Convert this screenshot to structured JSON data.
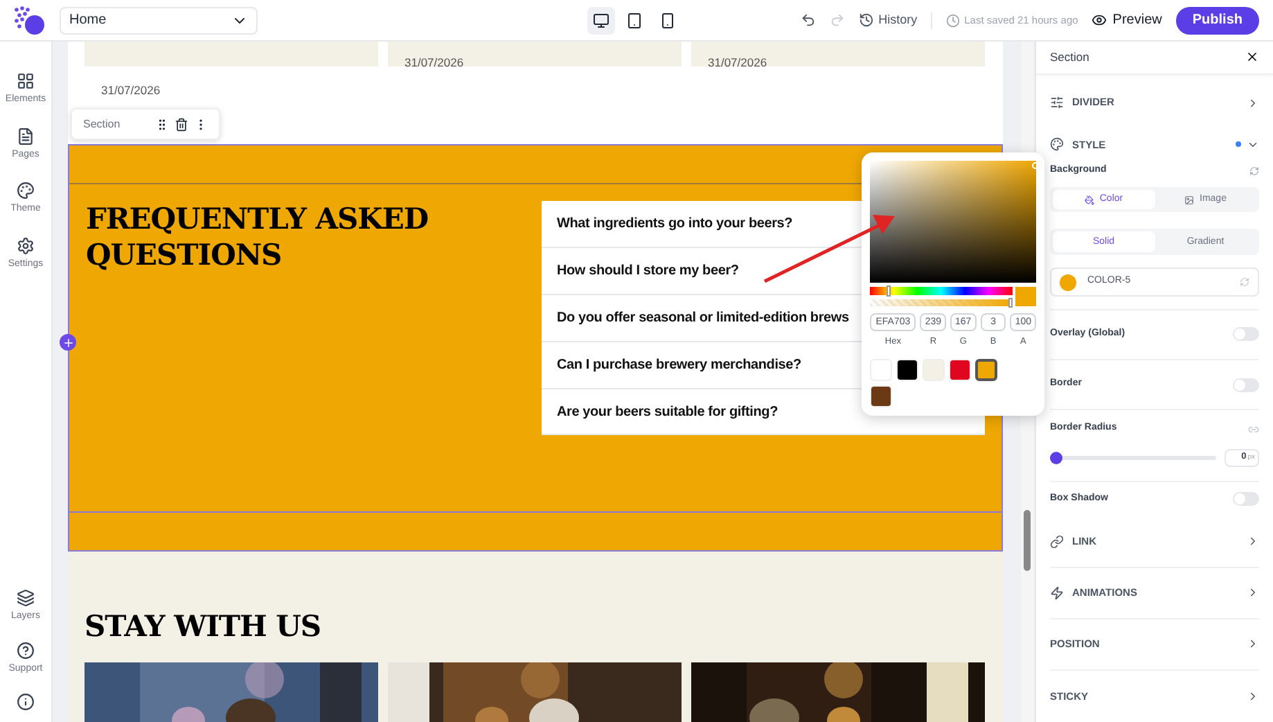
{
  "topbar": {
    "page_select": "Home",
    "devices": [
      {
        "kind": "desktop",
        "selected": true
      },
      {
        "kind": "tablet",
        "selected": false
      },
      {
        "kind": "phone",
        "selected": false
      }
    ],
    "history": "History",
    "last_saved": "Last saved 21 hours ago",
    "preview": "Preview",
    "publish": "Publish"
  },
  "left_nav": {
    "top": [
      {
        "kind": "elements",
        "label": "Elements"
      },
      {
        "kind": "pages",
        "label": "Pages"
      },
      {
        "kind": "theme",
        "label": "Theme"
      },
      {
        "kind": "settings",
        "label": "Settings"
      }
    ],
    "bottom": [
      {
        "kind": "layers",
        "label": "Layers"
      },
      {
        "kind": "support",
        "label": "Support"
      }
    ]
  },
  "canvas": {
    "dates": [
      "31/07/2026",
      "31/07/2026",
      "31/07/2026"
    ],
    "section_toolbar": "Section",
    "faq": {
      "title": "FREQUENTLY ASKED QUESTIONS",
      "color": "#efa703",
      "questions": [
        "What ingredients go into your beers?",
        "How should I store my beer?",
        "Do you offer seasonal or limited-edition brews",
        "Can I purchase brewery merchandise?",
        "Are your beers suitable for gifting?"
      ]
    },
    "stay": {
      "title": "STAY WITH US"
    }
  },
  "color_picker": {
    "hue": {
      "level": 0.12
    },
    "alpha": {
      "level": 1
    },
    "hex": "EFA703",
    "r": "239",
    "g": "167",
    "b": "3",
    "a": "100",
    "labels": [
      "Hex",
      "R",
      "G",
      "B",
      "A"
    ],
    "swatches": [
      {
        "color": "#ffffff",
        "selected": false
      },
      {
        "color": "#000000",
        "selected": false
      },
      {
        "color": "#f3f0e6",
        "selected": false
      },
      {
        "color": "#e0061f",
        "selected": false
      },
      {
        "color": "#efa703",
        "selected": true
      },
      {
        "color": "#6b3a14",
        "selected": false
      }
    ]
  },
  "panel": {
    "title": "Section",
    "divider": {
      "label": "DIVIDER",
      "expanded": false
    },
    "style": {
      "label": "STYLE",
      "expanded": true,
      "modified": true
    },
    "background": {
      "label": "Background",
      "types": [
        {
          "label": "Color",
          "selected": true
        },
        {
          "label": "Image",
          "selected": false
        }
      ],
      "fills": [
        {
          "label": "Solid",
          "selected": true
        },
        {
          "label": "Gradient",
          "selected": false
        }
      ],
      "color_name": "COLOR-5",
      "color": "#efa703"
    },
    "toggles": [
      {
        "label": "Overlay (Global)",
        "on": false
      },
      {
        "label": "Border",
        "on": false
      }
    ],
    "border_radius": {
      "label": "Border Radius",
      "level": 0,
      "value": "0",
      "unit": "px"
    },
    "box_shadow": {
      "label": "Box Shadow",
      "on": false
    },
    "groups": [
      {
        "kind": "link",
        "label": "LINK"
      },
      {
        "kind": "animations",
        "label": "ANIMATIONS"
      },
      {
        "kind": "position",
        "label": "POSITION"
      },
      {
        "kind": "sticky",
        "label": "STICKY"
      }
    ]
  }
}
